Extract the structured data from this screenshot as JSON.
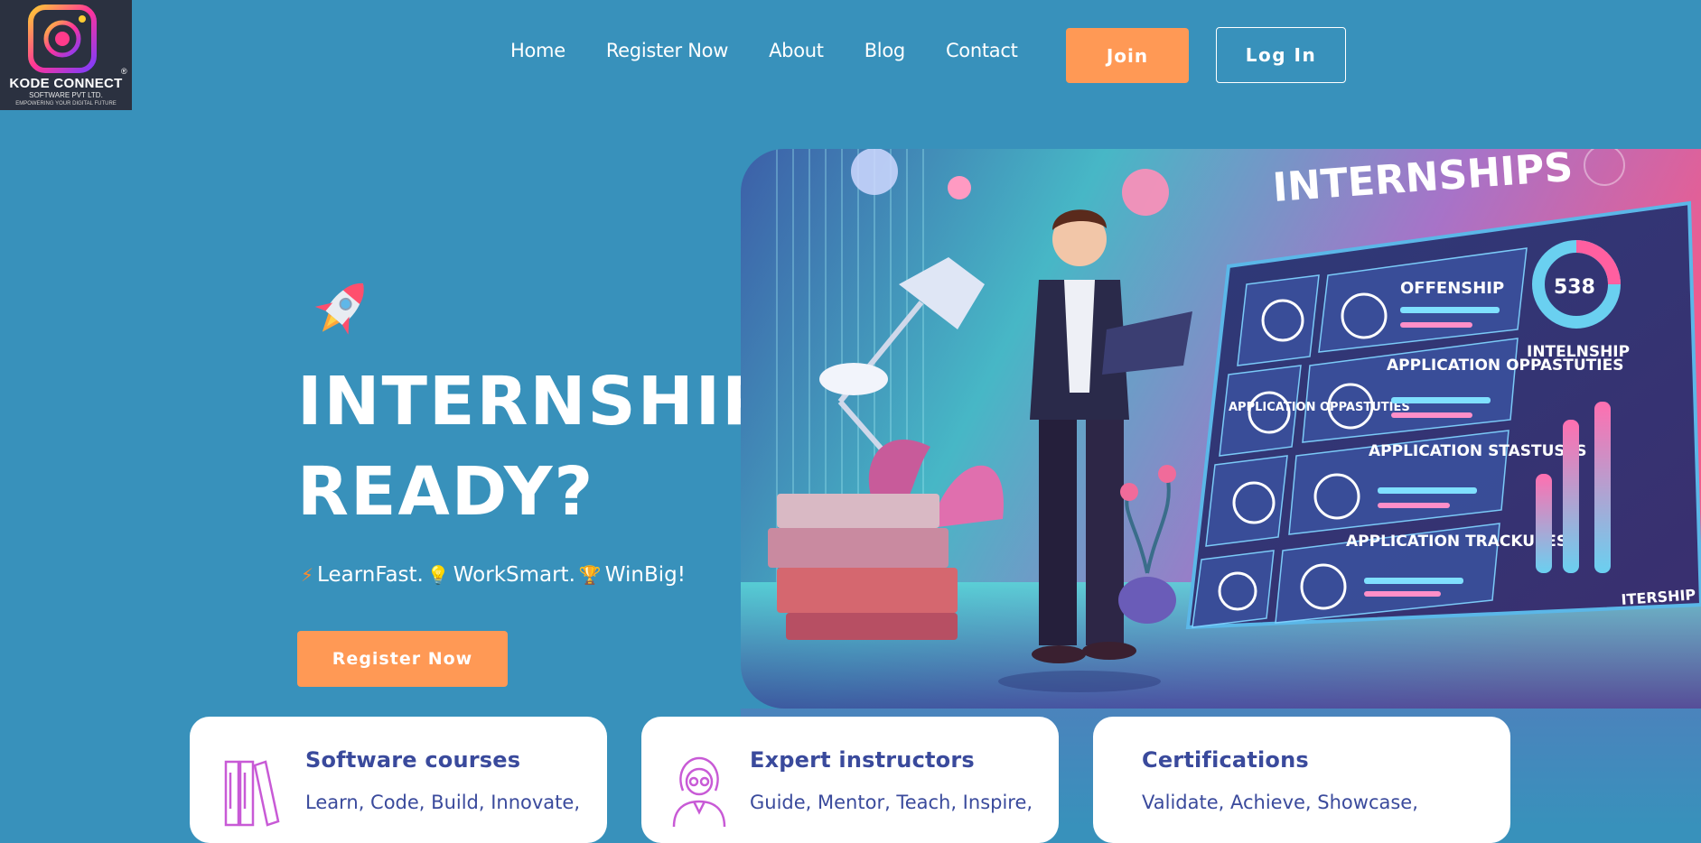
{
  "logo": {
    "name": "KODE CONNECT",
    "registered": "®",
    "subtitle": "SOFTWARE PVT LTD.",
    "slogan": "EMPOWERING YOUR DIGITAL FUTURE"
  },
  "nav": {
    "items": [
      "Home",
      "Register Now",
      "About",
      "Blog",
      "Contact"
    ],
    "join_label": "Join",
    "login_label": "Log In"
  },
  "hero": {
    "title_line1": "INTERNSHIP",
    "title_line2": "READY?",
    "tagline": {
      "learn": "LearnFast.",
      "work": "WorkSmart.",
      "win": "WinBig!"
    },
    "cta_label": "Register Now",
    "art": {
      "heading": "INTERNSHIPS",
      "panel_labels": [
        "OFFENSHIP",
        "APPLICATION OPPASTUTIES",
        "APPLICATION OPPASTUTIES",
        "APPLICATION STASTUSES",
        "APPLICATION TRACKUSESS",
        "INTELNSHIP",
        "ITERSHIP"
      ],
      "gauge_value": "538"
    }
  },
  "cards": [
    {
      "title": "Software courses",
      "text": "Learn, Code, Build, Innovate,",
      "icon": "books-icon"
    },
    {
      "title": "Expert instructors",
      "text": "Guide, Mentor, Teach, Inspire,",
      "icon": "instructor-icon"
    },
    {
      "title": "Certifications",
      "text": "Validate, Achieve, Showcase,",
      "icon": "certificate-icon"
    }
  ],
  "colors": {
    "background": "#3891bb",
    "accent": "#ff9955",
    "card_text": "#3a4a9c"
  }
}
